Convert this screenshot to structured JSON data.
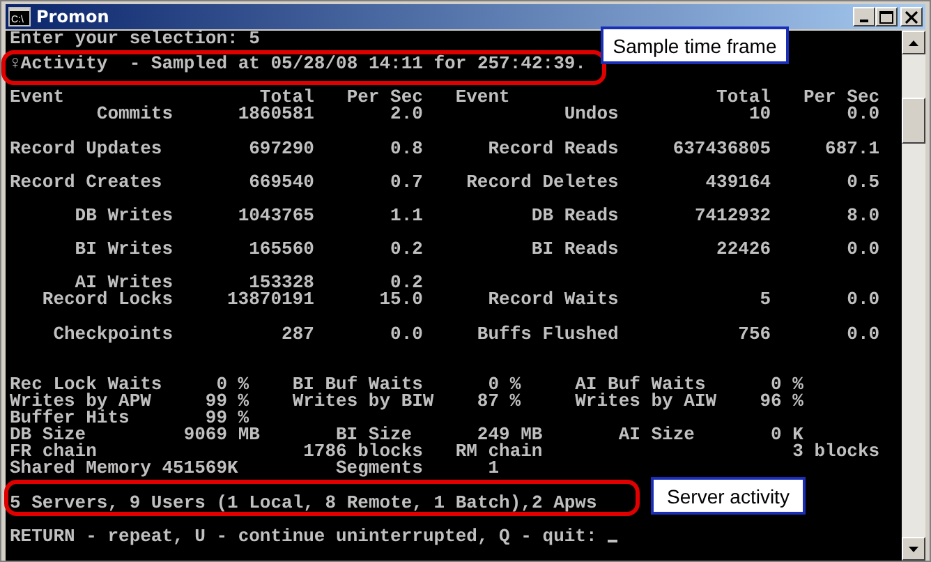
{
  "window": {
    "icon_label": "C:\\",
    "title": "Promon"
  },
  "console": {
    "input_line": "Enter your selection: 5",
    "sample_line": "♀Activity  - Sampled at 05/28/08 14:11 for 257:42:39.",
    "table": {
      "columns": [
        "Event",
        "Total",
        "Per Sec",
        "Event",
        "Total",
        "Per Sec"
      ],
      "row_groups": [
        {
          "rows": [
            {
              "cells": [
                "Commits",
                "1860581",
                "2.0",
                "Undos",
                "10",
                "0.0"
              ]
            }
          ]
        },
        {
          "rows": [
            {
              "cells": [
                "Record Updates",
                "697290",
                "0.8",
                "Record Reads",
                "637436805",
                "687.1"
              ]
            }
          ]
        },
        {
          "rows": [
            {
              "cells": [
                "Record Creates",
                "669540",
                "0.7",
                "Record Deletes",
                "439164",
                "0.5"
              ]
            }
          ]
        },
        {
          "rows": [
            {
              "cells": [
                "DB Writes",
                "1043765",
                "1.1",
                "DB Reads",
                "7412932",
                "8.0"
              ]
            }
          ]
        },
        {
          "rows": [
            {
              "cells": [
                "BI Writes",
                "165560",
                "0.2",
                "BI Reads",
                "22426",
                "0.0"
              ]
            }
          ]
        },
        {
          "rows": [
            {
              "cells": [
                "AI Writes",
                "153328",
                "0.2"
              ]
            },
            {
              "cells": [
                "Record Locks",
                "13870191",
                "15.0",
                "Record Waits",
                "5",
                "0.0"
              ]
            }
          ]
        },
        {
          "rows": [
            {
              "cells": [
                "Checkpoints",
                "287",
                "0.0",
                "Buffs Flushed",
                "756",
                "0.0"
              ]
            }
          ]
        }
      ]
    },
    "stats": [
      {
        "kind": "percent",
        "cells": [
          "Rec Lock Waits",
          "0 %",
          "BI Buf Waits",
          "0 %",
          "AI Buf Waits",
          "0 %"
        ]
      },
      {
        "kind": "percent",
        "cells": [
          "Writes by APW",
          "99 %",
          "Writes by BIW",
          "87 %",
          "Writes by AIW",
          "96 %"
        ]
      },
      {
        "kind": "percent",
        "cells": [
          "Buffer Hits",
          "99 %"
        ]
      },
      {
        "kind": "size",
        "cells": [
          "DB Size",
          "9069 MB",
          "BI Size",
          "249 MB",
          "AI Size",
          "0 K"
        ]
      },
      {
        "kind": "chain",
        "cells": [
          "FR chain",
          "1786 blocks",
          "RM chain",
          "3 blocks"
        ]
      },
      {
        "kind": "memory",
        "cells": [
          "Shared Memory",
          "451569K",
          "Segments",
          "1"
        ]
      }
    ],
    "server_line": "5 Servers, 9 Users (1 Local, 8 Remote, 1 Batch),2 Apws",
    "prompt": "RETURN - repeat, U - continue uninterrupted, Q - quit:"
  },
  "annotations": [
    {
      "text": "Sample time frame"
    },
    {
      "text": "Server activity"
    }
  ]
}
